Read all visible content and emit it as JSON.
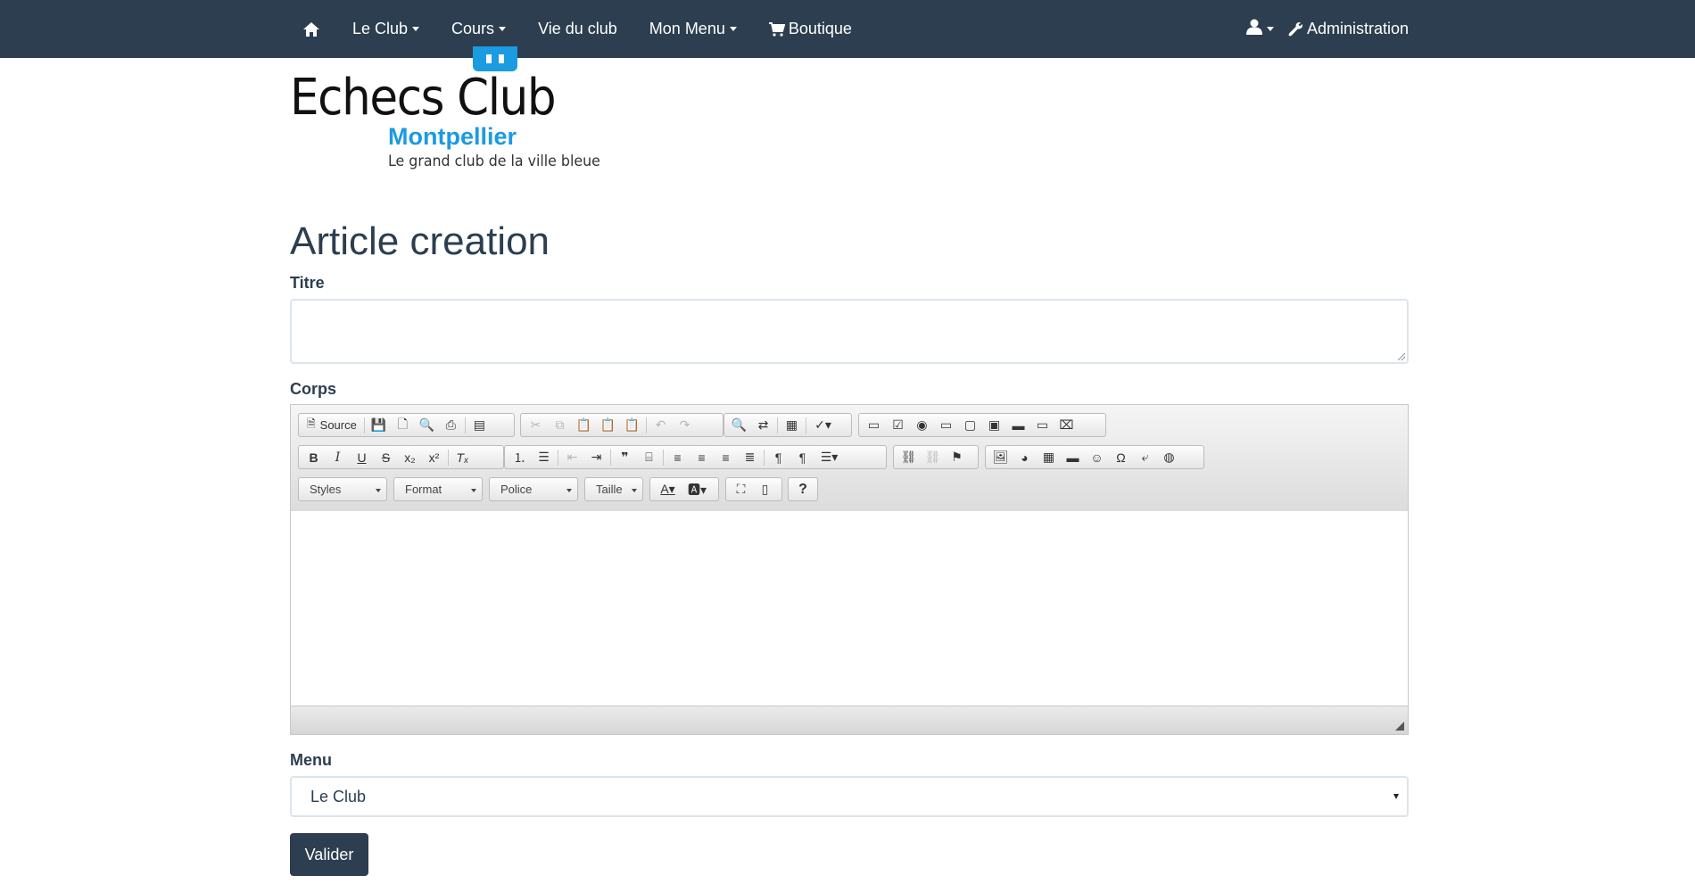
{
  "navbar": {
    "home_icon": "home-icon",
    "items": [
      {
        "label": "Le Club",
        "dropdown": true
      },
      {
        "label": "Cours",
        "dropdown": true
      },
      {
        "label": "Vie du club",
        "dropdown": false
      },
      {
        "label": "Mon Menu",
        "dropdown": true
      }
    ],
    "shop": {
      "label": "Boutique",
      "icon": "cart-icon"
    },
    "user": {
      "icon": "user-icon",
      "dropdown": true
    },
    "admin": {
      "label": "Administration",
      "icon": "wrench-icon"
    },
    "background": "#2c3e50"
  },
  "logo": {
    "main": "Echecs Club",
    "city": "Montpellier",
    "tagline": "Le grand club de la ville bleue",
    "accent_color": "#1b9be0"
  },
  "page": {
    "title": "Article creation"
  },
  "form": {
    "titre_label": "Titre",
    "titre_value": "",
    "corps_label": "Corps",
    "editor": {
      "source_label": "Source",
      "combos": [
        "Styles",
        "Format",
        "Police",
        "Taille"
      ],
      "content": ""
    },
    "menu_label": "Menu",
    "menu_selected": "Le Club",
    "submit_label": "Valider"
  }
}
